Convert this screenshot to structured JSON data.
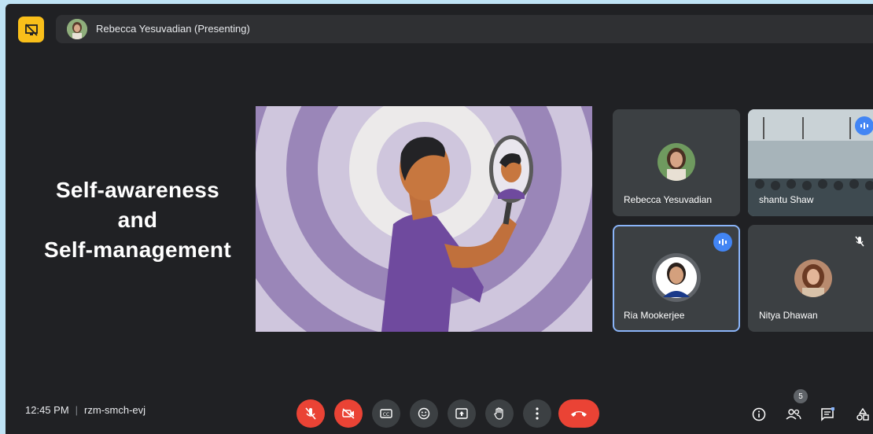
{
  "presenter": {
    "name": "Rebecca Yesuvadian (Presenting)"
  },
  "slide": {
    "line1": "Self-awareness",
    "line2": "and",
    "line3": "Self-management"
  },
  "participants": [
    {
      "name": "Rebecca Yesuvadian"
    },
    {
      "name": "shantu Shaw"
    },
    {
      "name": "Ria Mookerjee"
    },
    {
      "name": "Nitya Dhawan"
    }
  ],
  "meeting": {
    "time": "12:45 PM",
    "separator": "|",
    "code": "rzm-smch-evj",
    "participant_count": "5"
  },
  "colors": {
    "background": "#202124",
    "tile": "#3c4043",
    "danger": "#ea4335",
    "active_speaker": "#8ab4f8",
    "presenting": "#f9bf1a"
  }
}
